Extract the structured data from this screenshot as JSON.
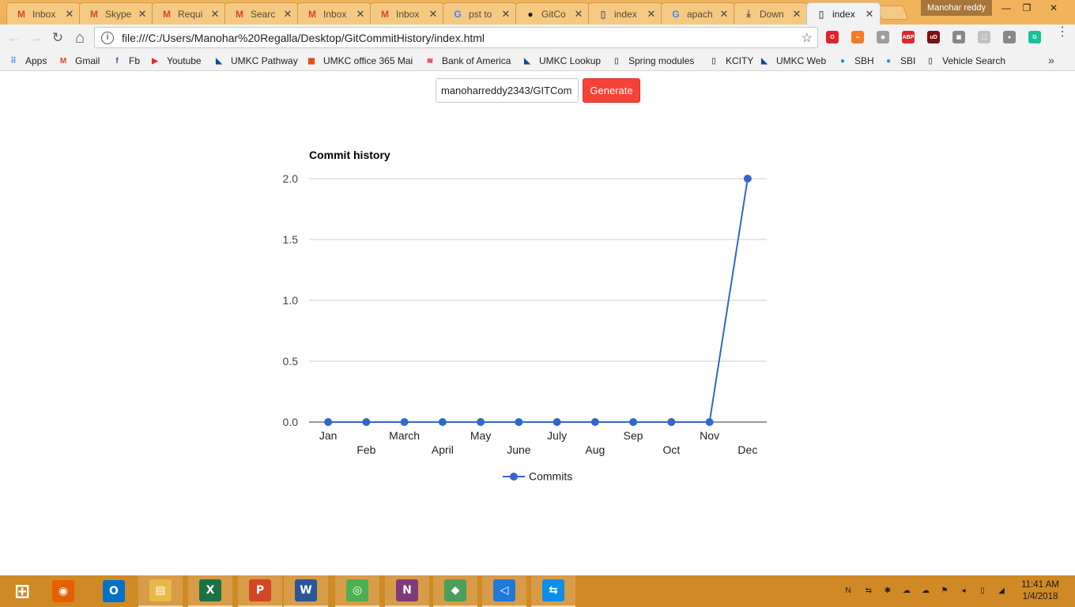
{
  "browser": {
    "tabs": [
      {
        "title": "Inbox",
        "icon": "gmail-icon",
        "icon_glyph": "M",
        "icon_color": "#d44638"
      },
      {
        "title": "Skype",
        "icon": "gmail-icon",
        "icon_glyph": "M",
        "icon_color": "#d44638"
      },
      {
        "title": "Requi",
        "icon": "gmail-icon",
        "icon_glyph": "M",
        "icon_color": "#d44638"
      },
      {
        "title": "Searc",
        "icon": "gmail-icon",
        "icon_glyph": "M",
        "icon_color": "#d44638"
      },
      {
        "title": "Inbox",
        "icon": "gmail-icon",
        "icon_glyph": "M",
        "icon_color": "#d44638"
      },
      {
        "title": "Inbox",
        "icon": "gmail-icon",
        "icon_glyph": "M",
        "icon_color": "#d44638"
      },
      {
        "title": "pst to",
        "icon": "google-icon",
        "icon_glyph": "G",
        "icon_color": "#4285f4"
      },
      {
        "title": "GitCo",
        "icon": "github-icon",
        "icon_glyph": "●",
        "icon_color": "#222222"
      },
      {
        "title": "index",
        "icon": "page-icon",
        "icon_glyph": "▯",
        "icon_color": "#666666"
      },
      {
        "title": "apach",
        "icon": "google-icon",
        "icon_glyph": "G",
        "icon_color": "#4285f4"
      },
      {
        "title": "Down",
        "icon": "download-icon",
        "icon_glyph": "⤓",
        "icon_color": "#555555"
      },
      {
        "title": "index",
        "icon": "page-icon",
        "icon_glyph": "▯",
        "icon_color": "#666666",
        "active": true
      }
    ],
    "tab_close_glyph": "✕",
    "profile_name": "Manohar reddy",
    "window_controls": {
      "minimize": "—",
      "restore": "❐",
      "close": "✕"
    },
    "url": "file:///C:/Users/Manohar%20Regalla/Desktop/GitCommitHistory/index.html",
    "nav": {
      "back": "←",
      "forward": "→",
      "reload": "↻",
      "home": "⌂",
      "star": "☆",
      "info": "i"
    },
    "extensions": [
      {
        "name": "opera-icon",
        "glyph": "O",
        "color": "#e0242e"
      },
      {
        "name": "infinity-icon",
        "glyph": "∞",
        "color": "#f27a24"
      },
      {
        "name": "cube-icon",
        "glyph": "◆",
        "color": "#9e9e9e"
      },
      {
        "name": "adblock-icon",
        "glyph": "ABP",
        "color": "#d9282f"
      },
      {
        "name": "ublock-icon",
        "glyph": "uD",
        "color": "#7a1115"
      },
      {
        "name": "extension-icon",
        "glyph": "▣",
        "color": "#888888"
      },
      {
        "name": "pdf-icon",
        "glyph": "⬚",
        "color": "#c2c2c2"
      },
      {
        "name": "shield-icon",
        "glyph": "●",
        "color": "#888888"
      },
      {
        "name": "grammarly-icon",
        "glyph": "G",
        "color": "#15c39a"
      }
    ],
    "menu_glyph": "⋮"
  },
  "bookmarks": [
    {
      "label": "Apps",
      "icon": "apps-icon",
      "glyph": "⠿",
      "color": "#4285f4"
    },
    {
      "label": "Gmail",
      "icon": "gmail-icon",
      "glyph": "M",
      "color": "#d44638"
    },
    {
      "label": "Fb",
      "icon": "facebook-icon",
      "glyph": "f",
      "color": "#3b5998"
    },
    {
      "label": "Youtube",
      "icon": "youtube-icon",
      "glyph": "▶",
      "color": "#e52d27"
    },
    {
      "label": "UMKC Pathway",
      "icon": "umkc-icon",
      "glyph": "◣",
      "color": "#0a4a9c"
    },
    {
      "label": "UMKC office 365 Mai",
      "icon": "office-icon",
      "glyph": "▦",
      "color": "#eb3c00"
    },
    {
      "label": "Bank of America",
      "icon": "bofa-icon",
      "glyph": "≋",
      "color": "#e31837"
    },
    {
      "label": "UMKC Lookup",
      "icon": "umkc-icon",
      "glyph": "◣",
      "color": "#0a4a9c"
    },
    {
      "label": "Spring modules",
      "icon": "page-icon",
      "glyph": "▯",
      "color": "#666666"
    },
    {
      "label": "KCITY",
      "icon": "page-icon",
      "glyph": "▯",
      "color": "#666666"
    },
    {
      "label": "UMKC Web",
      "icon": "umkc-icon",
      "glyph": "◣",
      "color": "#0a4a9c"
    },
    {
      "label": "SBH",
      "icon": "sbi-icon",
      "glyph": "●",
      "color": "#1f8fd6"
    },
    {
      "label": "SBI",
      "icon": "sbi-icon",
      "glyph": "●",
      "color": "#1f8fd6"
    },
    {
      "label": "Vehicle Search",
      "icon": "page-icon",
      "glyph": "▯",
      "color": "#666666"
    }
  ],
  "bookmarks_more": "»",
  "page": {
    "repo_value": "manoharreddy2343/GITCom",
    "generate_label": "Generate"
  },
  "chart_data": {
    "type": "line",
    "title": "Commit history",
    "xlabel": "",
    "ylabel": "",
    "categories": [
      "Jan",
      "Feb",
      "March",
      "April",
      "May",
      "June",
      "July",
      "Aug",
      "Sep",
      "Oct",
      "Nov",
      "Dec"
    ],
    "series": [
      {
        "name": "Commits",
        "values": [
          0,
          0,
          0,
          0,
          0,
          0,
          0,
          0,
          0,
          0,
          0,
          2
        ],
        "color": "#3366cc"
      }
    ],
    "ylim": [
      0,
      2
    ],
    "yticks": [
      "0.0",
      "0.5",
      "1.0",
      "1.5",
      "2.0"
    ],
    "grid": true,
    "legend": "bottom"
  },
  "taskbar": {
    "apps": [
      {
        "name": "start-icon",
        "glyph": "⊞",
        "color": "transparent"
      },
      {
        "name": "firefox-icon",
        "glyph": "◉",
        "color": "#e66000"
      },
      {
        "name": "outlook-icon",
        "glyph": "O",
        "color": "#0072c6"
      },
      {
        "name": "file-explorer-icon",
        "glyph": "▤",
        "color": "#e8b84a",
        "open": true
      },
      {
        "name": "excel-icon",
        "glyph": "X",
        "color": "#1e7145",
        "open": true
      },
      {
        "name": "powerpoint-icon",
        "glyph": "P",
        "color": "#d24726",
        "open": true
      },
      {
        "name": "word-icon",
        "glyph": "W",
        "color": "#2b579a",
        "open": true
      },
      {
        "name": "chrome-icon",
        "glyph": "◎",
        "color": "#4caf50",
        "open": true
      },
      {
        "name": "onenote-icon",
        "glyph": "N",
        "color": "#80397b",
        "open": true
      },
      {
        "name": "sourcetree-icon",
        "glyph": "◆",
        "color": "#4aa05a",
        "open": true
      },
      {
        "name": "vscode-icon",
        "glyph": "◁",
        "color": "#1f7ad8",
        "open": true
      },
      {
        "name": "teamviewer-icon",
        "glyph": "⇆",
        "color": "#0e8ee9",
        "open": true
      }
    ],
    "tray": [
      {
        "name": "onenote-tray-icon",
        "glyph": "N"
      },
      {
        "name": "teamviewer-tray-icon",
        "glyph": "⇆"
      },
      {
        "name": "app-tray-icon",
        "glyph": "✱"
      },
      {
        "name": "onedrive-icon",
        "glyph": "☁"
      },
      {
        "name": "onedrive-business-icon",
        "glyph": "☁"
      },
      {
        "name": "network-warning-icon",
        "glyph": "⚑"
      },
      {
        "name": "volume-icon",
        "glyph": "◂"
      },
      {
        "name": "battery-icon",
        "glyph": "▯"
      },
      {
        "name": "wifi-icon",
        "glyph": "◢"
      }
    ],
    "time": "11:41 AM",
    "date": "1/4/2018"
  }
}
